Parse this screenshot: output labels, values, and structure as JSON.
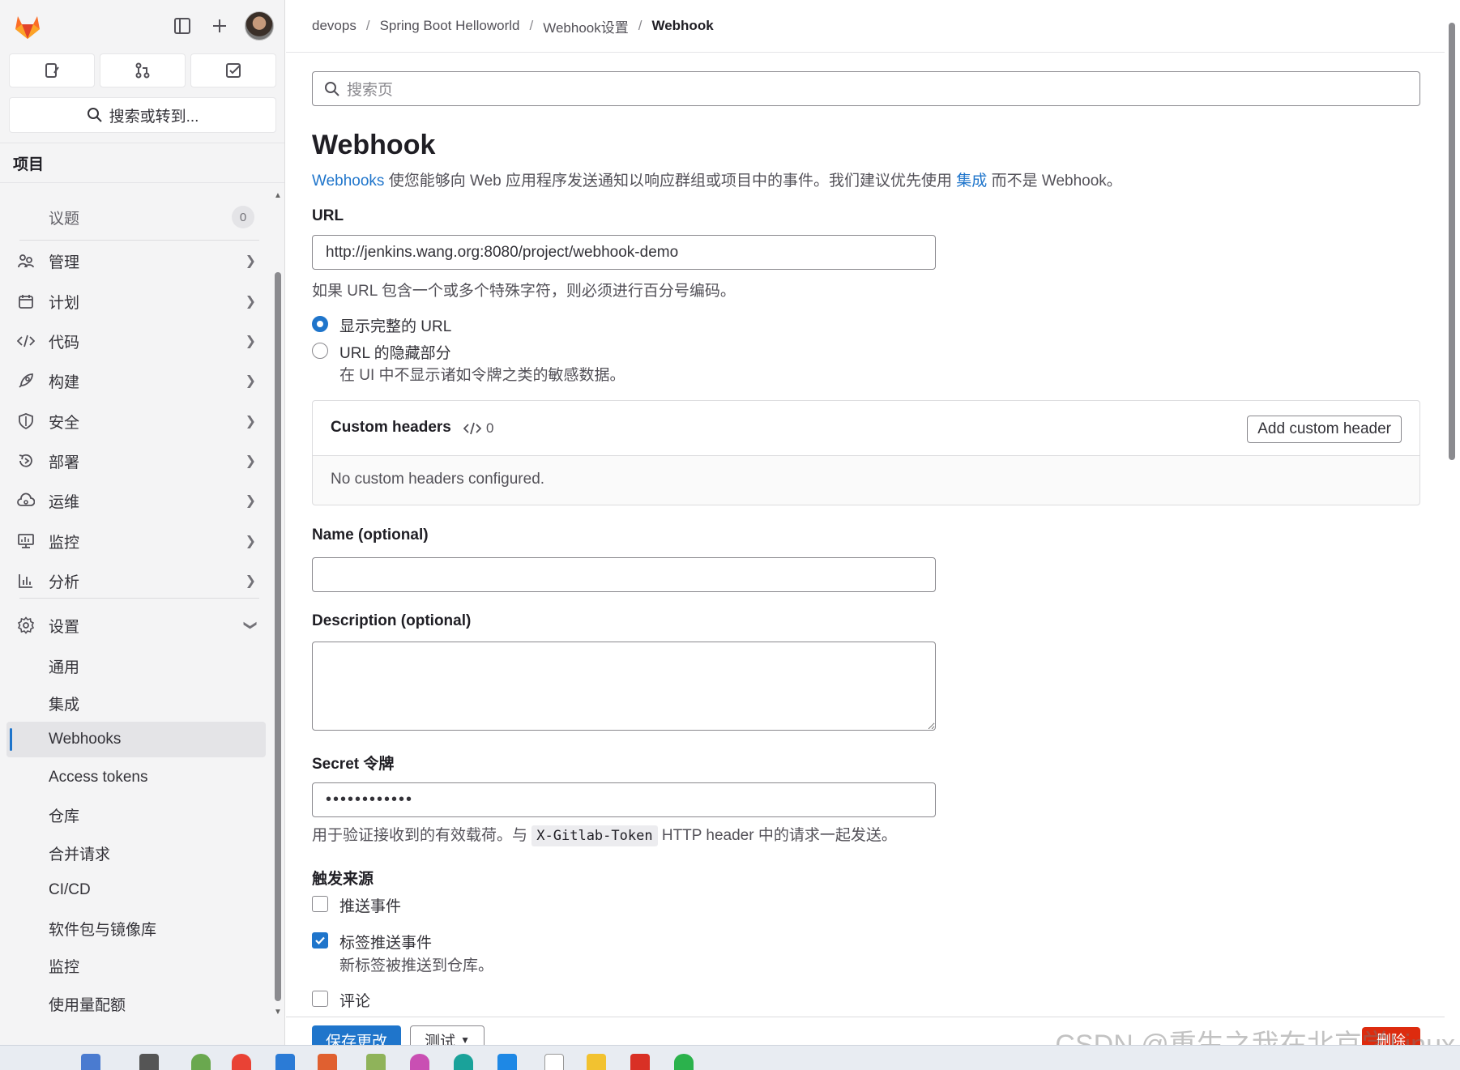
{
  "sidebar": {
    "quick_actions": [
      "issues-icon",
      "merge-request-icon",
      "todo-icon"
    ],
    "search_label": "搜索或转到...",
    "section_title": "项目",
    "items": [
      {
        "label": "议题",
        "icon": "issue-icon",
        "count": "0"
      },
      {
        "label": "管理",
        "icon": "users-icon"
      },
      {
        "label": "计划",
        "icon": "calendar-icon"
      },
      {
        "label": "代码",
        "icon": "code-icon"
      },
      {
        "label": "构建",
        "icon": "rocket-icon"
      },
      {
        "label": "安全",
        "icon": "shield-icon"
      },
      {
        "label": "部署",
        "icon": "deploy-icon"
      },
      {
        "label": "运维",
        "icon": "cloud-icon"
      },
      {
        "label": "监控",
        "icon": "monitor-icon"
      },
      {
        "label": "分析",
        "icon": "chart-icon"
      },
      {
        "label": "设置",
        "icon": "settings-icon"
      }
    ],
    "settings_sub": [
      "通用",
      "集成",
      "Webhooks",
      "Access tokens",
      "仓库",
      "合并请求",
      "CI/CD",
      "软件包与镜像库",
      "监控",
      "使用量配额"
    ]
  },
  "breadcrumb": [
    "devops",
    "Spring Boot Helloworld",
    "Webhook设置",
    "Webhook"
  ],
  "search": {
    "placeholder": "搜索页"
  },
  "page": {
    "title": "Webhook",
    "intro_link": "Webhooks",
    "intro_text_1": " 使您能够向 Web 应用程序发送通知以响应群组或项目中的事件。我们建议优先使用 ",
    "intro_link2": "集成",
    "intro_text_2": " 而不是 Webhook。"
  },
  "form": {
    "url_label": "URL",
    "url_value": "http://jenkins.wang.org:8080/project/webhook-demo",
    "url_help": "如果 URL 包含一个或多个特殊字符，则必须进行百分号编码。",
    "radio_show_full": "显示完整的 URL",
    "radio_mask": "URL 的隐藏部分",
    "radio_mask_help": "在 UI 中不显示诸如令牌之类的敏感数据。",
    "custom_headers_title": "Custom headers",
    "custom_headers_count": "0",
    "add_header_button": "Add custom header",
    "no_headers": "No custom headers configured.",
    "name_label": "Name (optional)",
    "description_label": "Description (optional)",
    "secret_label": "Secret 令牌",
    "secret_value": "••••••••••••",
    "secret_help_1": "用于验证接收到的有效载荷。与 ",
    "secret_help_code": "X-Gitlab-Token",
    "secret_help_2": " HTTP header 中的请求一起发送。",
    "trigger_title": "触发来源",
    "triggers": [
      {
        "label": "推送事件",
        "checked": false
      },
      {
        "label": "标签推送事件",
        "checked": true,
        "help": "新标签被推送到仓库。"
      },
      {
        "label": "评论",
        "checked": false
      }
    ]
  },
  "footer": {
    "save": "保存更改",
    "test": "测试",
    "delete": "删除"
  },
  "watermark": "CSDN @重生之我在北京学Linux",
  "colors": {
    "accent": "#1f75cb",
    "danger": "#dd2b0e",
    "logo": "#fc6d26"
  }
}
